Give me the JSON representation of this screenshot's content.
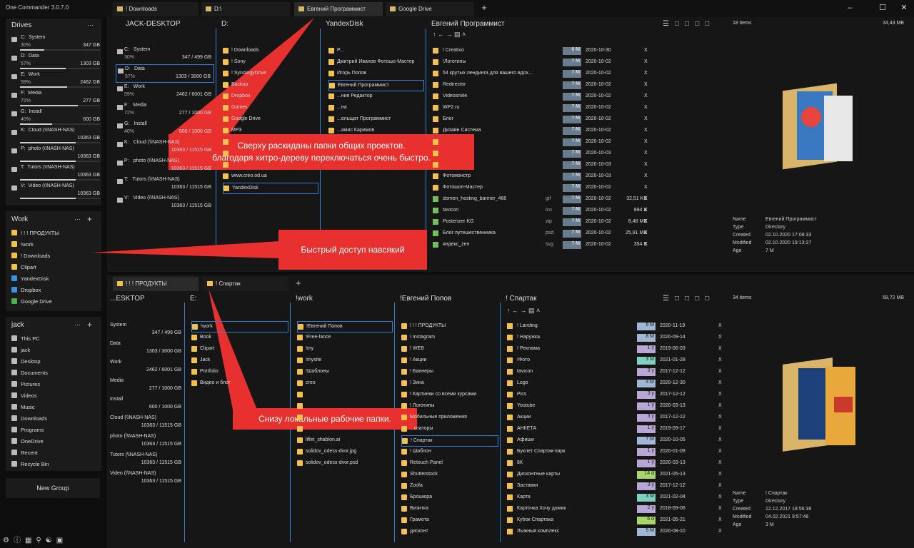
{
  "app": {
    "title": "One Commander 3.0.7.0"
  },
  "tabs_top": [
    "! Downloads",
    "D:\\",
    "Евгений Программист",
    "Google Drive"
  ],
  "tabs_bottom": [
    "! ! ! ПРОДУКТЫ",
    "! Спартак"
  ],
  "drives": {
    "title": "Drives",
    "items": [
      {
        "letter": "C:",
        "name": "System",
        "pct": "30%",
        "size": "347 GB",
        "fill": 30
      },
      {
        "letter": "D:",
        "name": "Data",
        "pct": "57%",
        "size": "1303 GB",
        "fill": 57
      },
      {
        "letter": "E:",
        "name": "Work",
        "pct": "59%",
        "size": "2462 GB",
        "fill": 59
      },
      {
        "letter": "F:",
        "name": "Media",
        "pct": "72%",
        "size": "277 GB",
        "fill": 72
      },
      {
        "letter": "G:",
        "name": "Install",
        "pct": "40%",
        "size": "600 GB",
        "fill": 40
      },
      {
        "letter": "K:",
        "name": "Cloud (\\\\NASH-NAS)",
        "pct": "",
        "size": "10363 GB",
        "fill": 70
      },
      {
        "letter": "P:",
        "name": "photo (\\\\NASH-NAS)",
        "pct": "",
        "size": "10363 GB",
        "fill": 70
      },
      {
        "letter": "T:",
        "name": "Tutors (\\\\NASH-NAS)",
        "pct": "",
        "size": "10363 GB",
        "fill": 70
      },
      {
        "letter": "V:",
        "name": "Video (\\\\NASH-NAS)",
        "pct": "",
        "size": "10363 GB",
        "fill": 70
      }
    ]
  },
  "work_group": {
    "title": "Work",
    "items": [
      "! ! ! ПРОДУКТЫ",
      "!work",
      "! Downloads",
      "Clipart",
      "YandexDisk",
      "Dropbox",
      "Google Drive"
    ]
  },
  "jack_group": {
    "title": "jack",
    "items": [
      "This PC",
      "jack",
      "Desktop",
      "Documents",
      "Pictures",
      "Videos",
      "Music",
      "Downloads",
      "Programs",
      "OneDrive",
      "Recent",
      "Recycle Bin"
    ]
  },
  "new_group": "New Group",
  "top": {
    "col1_title": "JACK-DESKTOP",
    "col1_drives": [
      {
        "letter": "C:",
        "name": "System",
        "pct": "30%",
        "size": "347 / 499 GB"
      },
      {
        "letter": "D:",
        "name": "Data",
        "pct": "57%",
        "size": "1303 / 3000 GB"
      },
      {
        "letter": "E:",
        "name": "Work",
        "pct": "59%",
        "size": "2462 / 6001 GB"
      },
      {
        "letter": "F:",
        "name": "Media",
        "pct": "72%",
        "size": "277 / 1000 GB"
      },
      {
        "letter": "G:",
        "name": "Install",
        "pct": "40%",
        "size": "600 / 1000 GB"
      },
      {
        "letter": "K:",
        "name": "Cloud (\\\\NASH-NAS)",
        "pct": "",
        "size": "10363 / 11515 GB"
      },
      {
        "letter": "P:",
        "name": "photo (\\\\NASH-NAS)",
        "pct": "",
        "size": "10363 / 11515 GB"
      },
      {
        "letter": "T:",
        "name": "Tutors (\\\\NASH-NAS)",
        "pct": "",
        "size": "10363 / 11515 GB"
      },
      {
        "letter": "V:",
        "name": "Video (\\\\NASH-NAS)",
        "pct": "",
        "size": "10363 / 11515 GB"
      }
    ],
    "col2_title": "D:",
    "col2_items": [
      "! Downloads",
      "! Sony",
      "! SynologyDrive",
      "Backup",
      "Dropbox",
      "Games",
      "Google Drive",
      "MP3",
      "",
      "",
      "",
      "www.creo.od.ua",
      "YandexDisk"
    ],
    "col3_title": "YandexDisk",
    "col3_items": [
      "Р...",
      "Дмитрий Иванов Фотошо-Мастер",
      "Игорь Попов",
      "Евгений Программист",
      "...ния Редактор",
      "...на",
      "...ельщат Программист",
      "...амис Каримов"
    ],
    "col4_title": "Евгений Программист",
    "col4_rows": [
      {
        "name": "! Creativo",
        "ext": "",
        "age": "6 M",
        "date": "2020-10-30",
        "size": ""
      },
      {
        "name": "!Логотипы",
        "ext": "",
        "age": "7 M",
        "date": "2020-10-02",
        "size": ""
      },
      {
        "name": "54 крутых лендинга для вашего вдох...",
        "ext": "",
        "age": "7 M",
        "date": "2020-10-02",
        "size": ""
      },
      {
        "name": "Redirector",
        "ext": "",
        "age": "7 M",
        "date": "2020-10-02",
        "size": ""
      },
      {
        "name": "Videosmile",
        "ext": "",
        "age": "7 M",
        "date": "2020-10-02",
        "size": ""
      },
      {
        "name": "WP2.ru",
        "ext": "",
        "age": "7 M",
        "date": "2020-10-02",
        "size": ""
      },
      {
        "name": "Блог",
        "ext": "",
        "age": "7 M",
        "date": "2020-10-02",
        "size": ""
      },
      {
        "name": "Дизайн Система",
        "ext": "",
        "age": "7 M",
        "date": "2020-10-02",
        "size": ""
      },
      {
        "name": "",
        "ext": "",
        "age": "7 M",
        "date": "2020-10-02",
        "size": ""
      },
      {
        "name": "",
        "ext": "",
        "age": "7 M",
        "date": "2020-10-03",
        "size": ""
      },
      {
        "name": "",
        "ext": "",
        "age": "7 M",
        "date": "2020-10-03",
        "size": ""
      },
      {
        "name": "Фотомонстр",
        "ext": "",
        "age": "7 M",
        "date": "2020-10-03",
        "size": ""
      },
      {
        "name": "Фотошоп-Мастер",
        "ext": "",
        "age": "7 M",
        "date": "2020-10-02",
        "size": ""
      },
      {
        "name": "domen_hosting_banner_468",
        "ext": "gif",
        "age": "7 M",
        "date": "2020-10-02",
        "size": "32,51 KB"
      },
      {
        "name": "favicon",
        "ext": "ico",
        "age": "7 M",
        "date": "2020-10-02",
        "size": "894 B"
      },
      {
        "name": "Posterizer KG",
        "ext": "zip",
        "age": "7 M",
        "date": "2020-10-02",
        "size": "8,48 MB"
      },
      {
        "name": "Блог путешественника",
        "ext": "psd",
        "age": "7 M",
        "date": "2020-10-02",
        "size": "25,91 MB"
      },
      {
        "name": "яндекс_zen",
        "ext": "svg",
        "age": "7 M",
        "date": "2020-10-02",
        "size": "354 B"
      }
    ],
    "items_count": "18 items",
    "total_size": "34,43 MB",
    "props": [
      [
        "Name",
        "Евгений Программист"
      ],
      [
        "Type",
        "Directory"
      ],
      [
        "Created",
        "02.10.2020 17:08:33"
      ],
      [
        "Modified",
        "02.10.2020 19:13:37"
      ],
      [
        "Age",
        "7 M"
      ]
    ]
  },
  "bottom": {
    "col1_title": "...ESKTOP",
    "col1_drives": [
      {
        "name": "System",
        "size": "347 / 499 GB"
      },
      {
        "name": "Data",
        "size": "1303 / 3000 GB"
      },
      {
        "name": "Work",
        "size": "2462 / 6001 GB"
      },
      {
        "name": "Media",
        "size": "277 / 1000 GB"
      },
      {
        "name": "Install",
        "size": "600 / 1000 GB"
      },
      {
        "name": "Cloud (\\\\NASH-NAS)",
        "size": "10363 / 11515 GB"
      },
      {
        "name": "photo (\\\\NASH-NAS)",
        "size": "10363 / 11515 GB"
      },
      {
        "name": "Tutors (\\\\NASH-NAS)",
        "size": "10363 / 11515 GB"
      },
      {
        "name": "Video (\\\\NASH-NAS)",
        "size": "10363 / 11515 GB"
      }
    ],
    "col2_title": "E:",
    "col2_items": [
      "!work",
      "Book",
      "Clipart",
      "Jack",
      "Portfolio",
      "Видео и блог"
    ],
    "col3_title": "!work",
    "col3_items": [
      "!Евгений Попов",
      "!Free-lance",
      "!my",
      "!mysite",
      "!Шаблоны",
      "creo",
      "",
      "",
      "",
      "",
      "liflet_shablon.ai",
      "solidov_odess-dvor.jpg",
      "solidov_odess-dvor.psd"
    ],
    "col4_title": "!Евгений Попов",
    "col4_items": [
      "! ! ! ПРОДУКТЫ",
      "! Instagram",
      "! WEB",
      "! Акции",
      "! Баннеры",
      "! Зина",
      "! Картинки со всеми курсами",
      "! Логотипы",
      "Мобильные приложения",
      "...отаторы",
      "! Спартак",
      "! Шаблон",
      "Retouch Panel",
      "Shutterstock",
      "Zoofa",
      "Брошюра",
      "Визитка",
      "Грамота",
      "дисконт"
    ],
    "col5_title": "! Спартак",
    "col5_rows": [
      {
        "name": "! Landing",
        "age": "6 M",
        "date": "2020-11-19",
        "color": "#9fb6d6"
      },
      {
        "name": "! Наружка",
        "age": "8 M",
        "date": "2020-09-14",
        "color": "#9fb6d6"
      },
      {
        "name": "! Реклама",
        "age": "1 y",
        "date": "2019-06-03",
        "color": "#b7a6d6"
      },
      {
        "name": "!Фото",
        "age": "3 M",
        "date": "2021-01-28",
        "color": "#7fd0c2"
      },
      {
        "name": "favicon",
        "age": "3 y",
        "date": "2017-12-12",
        "color": "#b7a6d6"
      },
      {
        "name": "Logo",
        "age": "4 M",
        "date": "2020-12-30",
        "color": "#9fb6d6"
      },
      {
        "name": "Pics",
        "age": "3 y",
        "date": "2017-12-12",
        "color": "#b7a6d6"
      },
      {
        "name": "Youtube",
        "age": "1 y",
        "date": "2020-03-13",
        "color": "#b7a6d6"
      },
      {
        "name": "Акции",
        "age": "3 y",
        "date": "2017-12-12",
        "color": "#b7a6d6"
      },
      {
        "name": "АНКЕТА",
        "age": "1 y",
        "date": "2019-09-17",
        "color": "#b7a6d6"
      },
      {
        "name": "Афиши",
        "age": "7 M",
        "date": "2020-10-05",
        "color": "#9fb6d6"
      },
      {
        "name": "Буклет Спартак-парк",
        "age": "1 y",
        "date": "2020-01-09",
        "color": "#b7a6d6"
      },
      {
        "name": "8К",
        "age": "1 y",
        "date": "2020-03-13",
        "color": "#b7a6d6"
      },
      {
        "name": "Дисконтные карты",
        "age": "14 d",
        "date": "2021-05-13",
        "color": "#a9d66b"
      },
      {
        "name": "Заставки",
        "age": "3 y",
        "date": "2017-12-12",
        "color": "#b7a6d6"
      },
      {
        "name": "Карта",
        "age": "3 M",
        "date": "2021-02-04",
        "color": "#7fd0c2"
      },
      {
        "name": "Карточка Хочу домик",
        "age": "2 y",
        "date": "2018-09-06",
        "color": "#b7a6d6"
      },
      {
        "name": "Кубок Спартака",
        "age": "6 d",
        "date": "2021-05-21",
        "color": "#a9d66b"
      },
      {
        "name": "Лыжный комплекс",
        "age": "9 M",
        "date": "2020-08-10",
        "color": "#9fb6d6"
      }
    ],
    "items_count": "34 items",
    "total_size": "58,72 MB",
    "props": [
      [
        "Name",
        "! Спартак"
      ],
      [
        "Type",
        "Directory"
      ],
      [
        "Created",
        "12.12.2017 18:56:38"
      ],
      [
        "Modified",
        "04.02.2021 9:57:48"
      ],
      [
        "Age",
        "3 M"
      ]
    ]
  },
  "callouts": {
    "top": "Сверху раскиданы папки общих проектов.\nблагодаря хитро-дереву переключаться очень быстро.",
    "middle": "Быстрый доступ навсякий",
    "bottom": "Снизу локальные рабочие папки."
  },
  "colors": {
    "accent": "#2d7fd2",
    "folder": "#f3c14c",
    "callout": "#e8312f"
  }
}
